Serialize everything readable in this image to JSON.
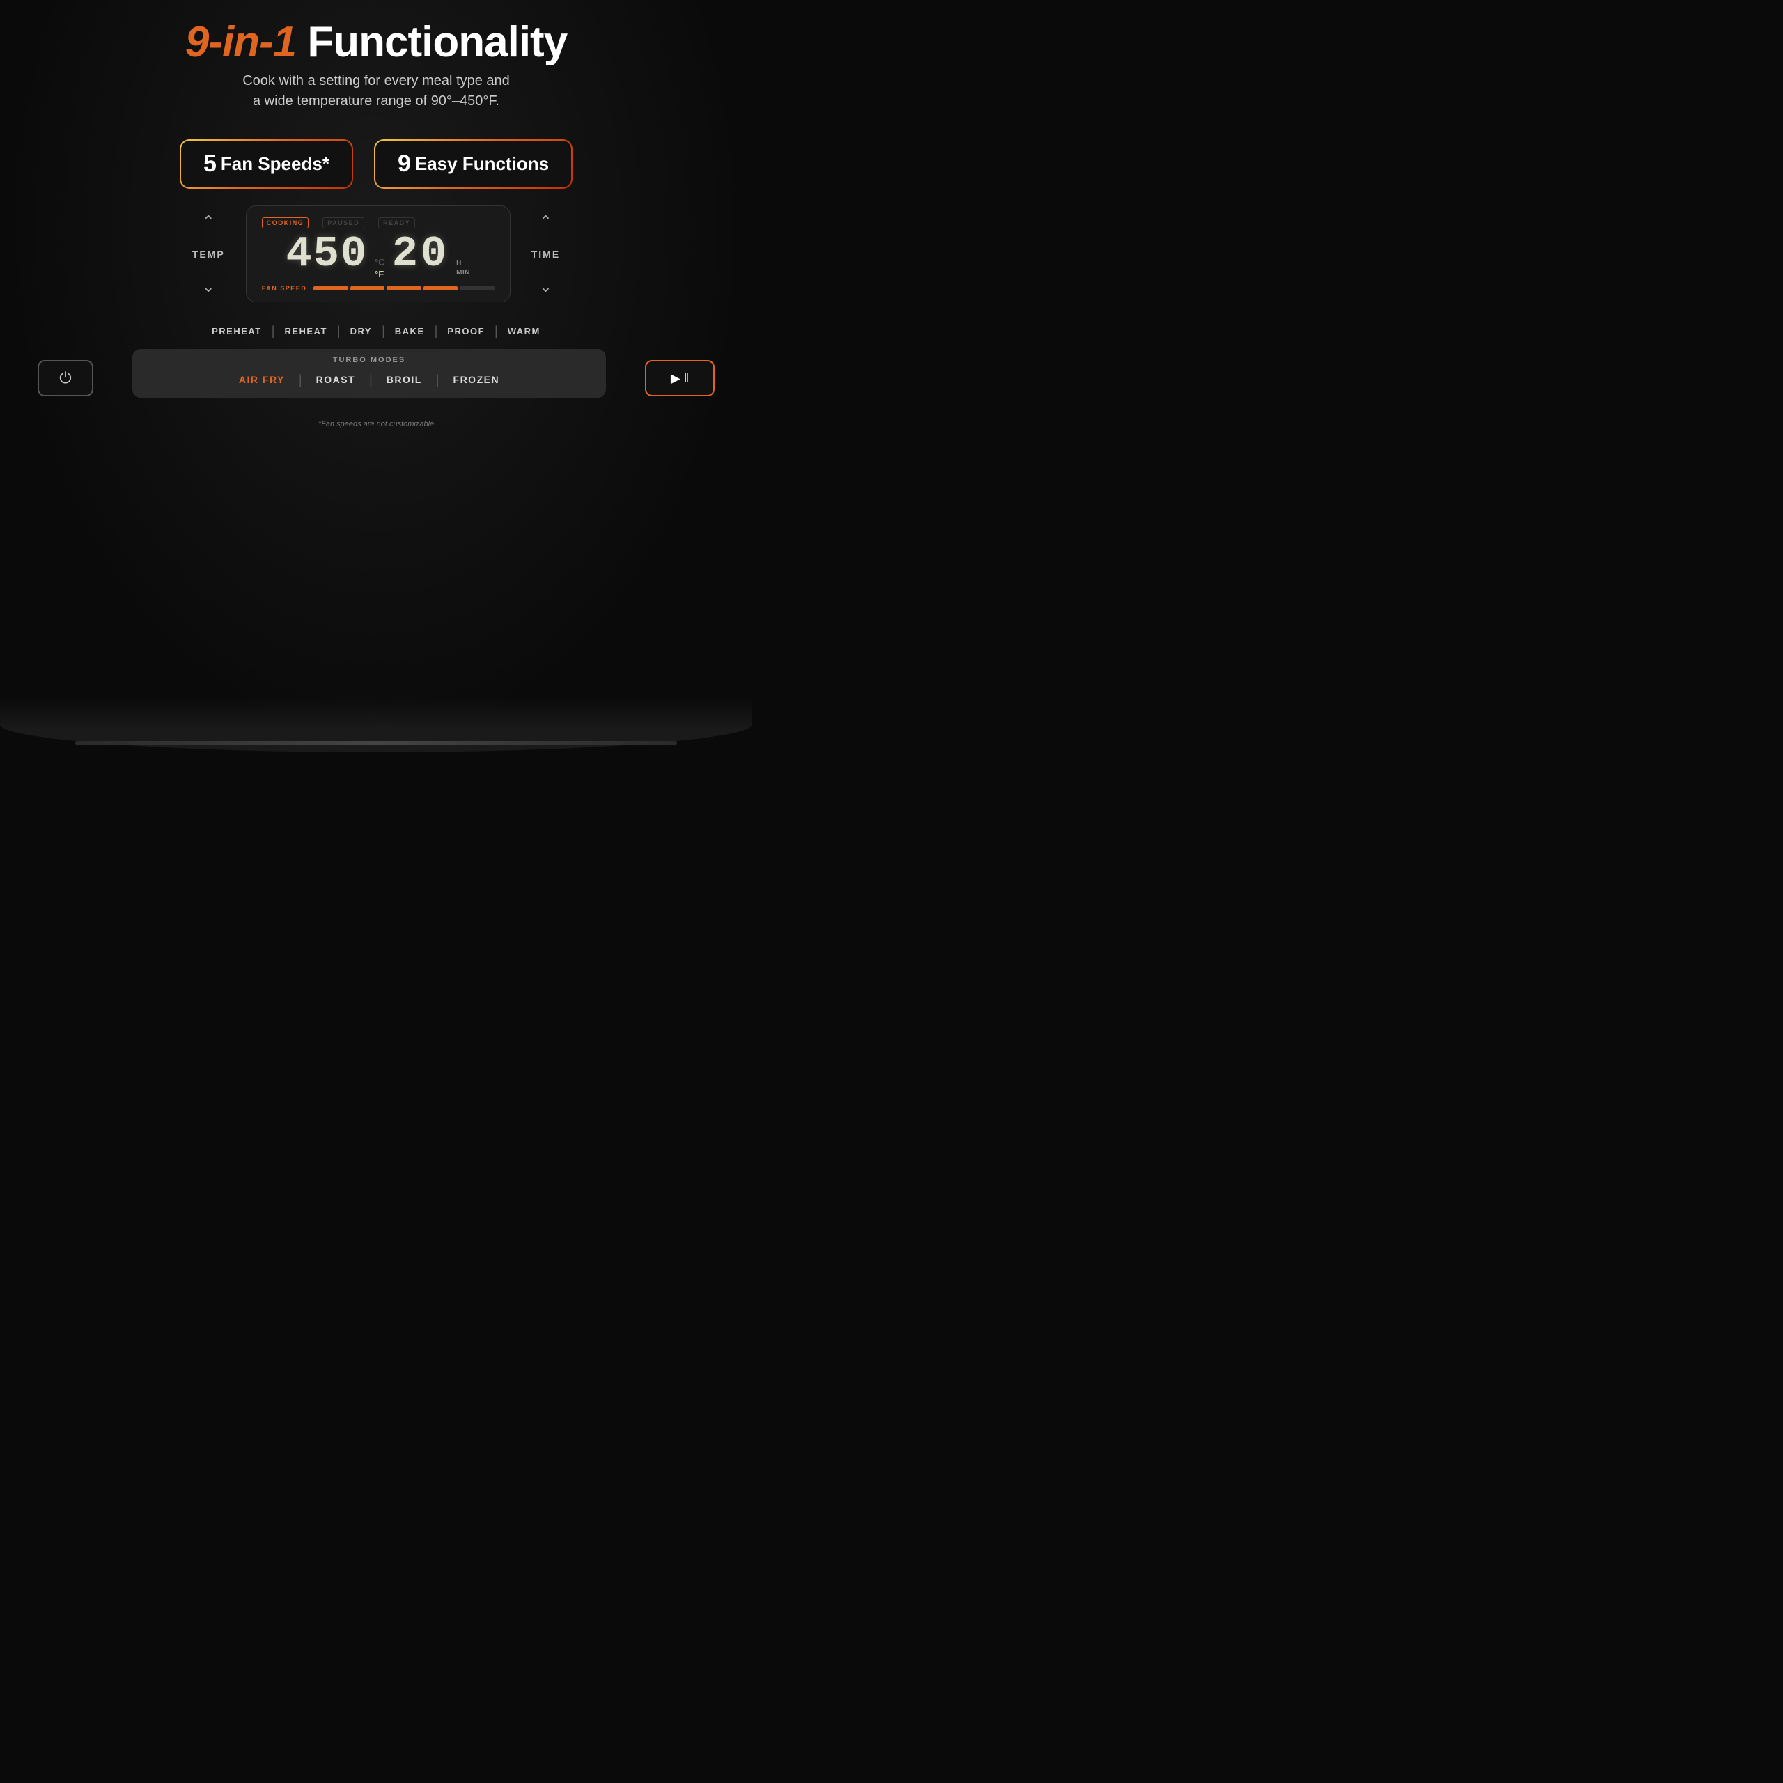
{
  "header": {
    "title_orange": "9-in-1",
    "title_white": " Functionality",
    "subtitle_line1": "Cook with a setting for every meal type and",
    "subtitle_line2": "a wide temperature range of 90°–450°F."
  },
  "badges": [
    {
      "number": "5",
      "label": "Fan Speeds*"
    },
    {
      "number": "9",
      "label": "Easy Functions"
    }
  ],
  "display": {
    "status_cooking": "COOKING",
    "status_paused": "PAUSED",
    "status_ready": "READY",
    "temp_value": "450",
    "temp_unit_c": "°C",
    "temp_unit_f": "°F",
    "time_value": "20",
    "time_unit_h": "H",
    "time_unit_min": "MIN",
    "fan_speed_label": "FAN SPEED",
    "fan_filled": 4,
    "fan_total": 5
  },
  "temp_control": {
    "label": "TEMP"
  },
  "time_control": {
    "label": "TIME"
  },
  "functions": [
    "PREHEAT",
    "REHEAT",
    "DRY",
    "BAKE",
    "PROOF",
    "WARM"
  ],
  "turbo": {
    "label": "TURBO MODES",
    "modes": [
      {
        "label": "AIR FRY",
        "active": true
      },
      {
        "label": "ROAST",
        "active": false
      },
      {
        "label": "BROIL",
        "active": false
      },
      {
        "label": "FROZEN",
        "active": false
      }
    ]
  },
  "buttons": {
    "power_label": "⏻",
    "play_pause_label": "▶ ‖"
  },
  "footer": {
    "note": "*Fan speeds are not customizable"
  }
}
